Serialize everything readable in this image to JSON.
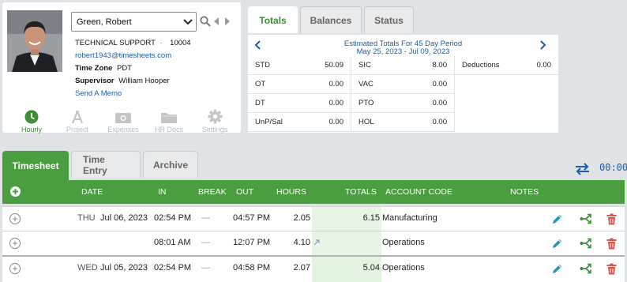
{
  "employee": {
    "selected": "Green, Robert",
    "department": "TECHNICAL SUPPORT",
    "dept_sep": "·",
    "employee_no": "10004",
    "email": "robert1943@timesheets.com",
    "timezone_label": "Time Zone",
    "timezone": "PDT",
    "supervisor_label": "Supervisor",
    "supervisor": "William Hooper",
    "memo_link": "Send A Memo"
  },
  "nav": [
    {
      "label": "Hourly",
      "icon": "clock-icon"
    },
    {
      "label": "Project",
      "icon": "compass-icon"
    },
    {
      "label": "Expenses",
      "icon": "money-icon"
    },
    {
      "label": "HR Docs",
      "icon": "folder-icon"
    },
    {
      "label": "Settings",
      "icon": "gear-icon"
    }
  ],
  "totals_tabs": [
    "Totals",
    "Balances",
    "Status"
  ],
  "totals": {
    "period_title": "Estimated Totals For 45 Day Period",
    "period_range": "May 25, 2023 - Jul 09, 2023",
    "cells": [
      {
        "label": "STD",
        "value": "50.09"
      },
      {
        "label": "SIC",
        "value": "8.00"
      },
      {
        "label": "Deductions",
        "value": "0.00"
      },
      {
        "label": "OT",
        "value": "0.00"
      },
      {
        "label": "VAC",
        "value": "0.00"
      },
      {
        "label": "DT",
        "value": "0.00"
      },
      {
        "label": "PTO",
        "value": "0.00"
      },
      {
        "label": "UnP/Sal",
        "value": "0.00"
      },
      {
        "label": "HOL",
        "value": "0.00"
      }
    ]
  },
  "ts_tabs": [
    "Timesheet",
    "Time Entry",
    "Archive"
  ],
  "timer": "00:00",
  "columns": {
    "date": "DATE",
    "in": "IN",
    "break": "BREAK",
    "out": "OUT",
    "hours": "HOURS",
    "totals": "TOTALS",
    "account": "ACCOUNT CODE",
    "notes": "NOTES"
  },
  "rows": [
    {
      "day": "THU",
      "date": "Jul 06, 2023",
      "in": "02:54 PM",
      "break": "—",
      "out": "04:57 PM",
      "hours": "2.05",
      "total": "6.15",
      "account": "Manufacturing"
    },
    {
      "day": "",
      "date": "",
      "in": "08:01 AM",
      "break": "—",
      "out": "12:07 PM",
      "hours": "4.10",
      "total": "",
      "account": "Operations"
    },
    {
      "day": "WED",
      "date": "Jul 05, 2023",
      "in": "02:54 PM",
      "break": "—",
      "out": "04:58 PM",
      "hours": "2.07",
      "total": "5.04",
      "account": "Operations"
    }
  ],
  "colors": {
    "accent": "#4a9e3f",
    "link": "#1f5ba8",
    "edit": "#1a9bb0",
    "split": "#3d8e35",
    "delete": "#d9534f"
  }
}
